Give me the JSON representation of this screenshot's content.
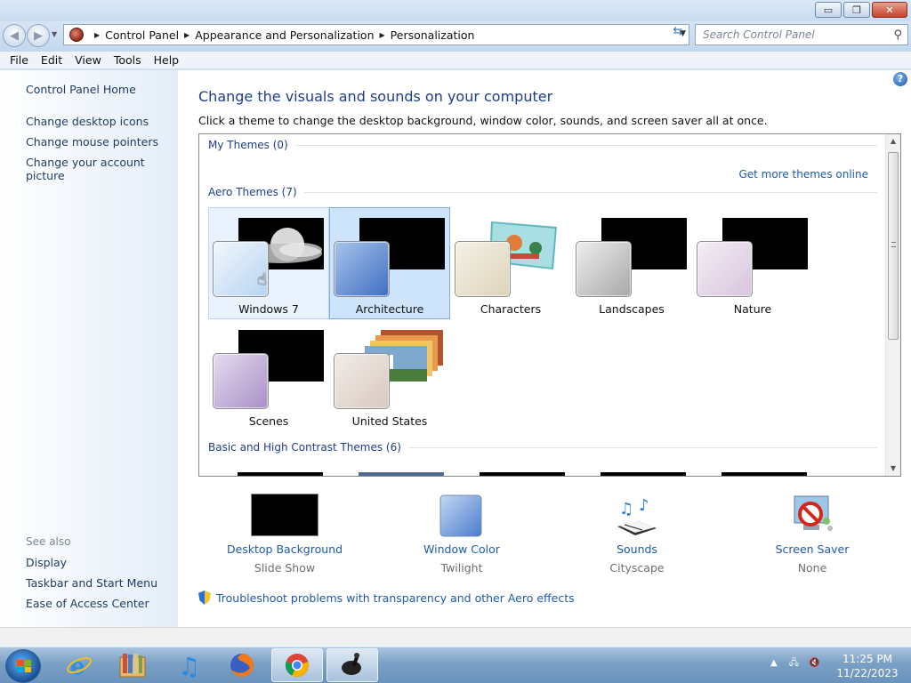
{
  "window": {
    "minimize_glyph": "▭",
    "restore_glyph": "❐",
    "close_glyph": "✕"
  },
  "address": {
    "crumbs": [
      "Control Panel",
      "Appearance and Personalization",
      "Personalization"
    ],
    "search_placeholder": "Search Control Panel"
  },
  "menu": [
    "File",
    "Edit",
    "View",
    "Tools",
    "Help"
  ],
  "sidebar": {
    "home": "Control Panel Home",
    "tasks": [
      "Change desktop icons",
      "Change mouse pointers",
      "Change your account picture"
    ],
    "see_also_label": "See also",
    "see_also": [
      "Display",
      "Taskbar and Start Menu",
      "Ease of Access Center"
    ]
  },
  "main": {
    "title": "Change the visuals and sounds on your computer",
    "subtitle": "Click a theme to change the desktop background, window color, sounds, and screen saver all at once.",
    "get_more_link": "Get more themes online",
    "groups": {
      "my_themes": "My Themes (0)",
      "aero_themes": "Aero Themes (7)",
      "basic_themes": "Basic and High Contrast Themes (6)"
    },
    "themes": [
      {
        "name": "Windows 7",
        "state": "hover"
      },
      {
        "name": "Architecture",
        "state": "selected"
      },
      {
        "name": "Characters",
        "state": "normal"
      },
      {
        "name": "Landscapes",
        "state": "normal"
      },
      {
        "name": "Nature",
        "state": "normal"
      },
      {
        "name": "Scenes",
        "state": "normal"
      },
      {
        "name": "United States",
        "state": "normal"
      }
    ]
  },
  "settings": [
    {
      "label": "Desktop Background",
      "value": "Slide Show",
      "icon": "desktop-background-icon"
    },
    {
      "label": "Window Color",
      "value": "Twilight",
      "icon": "window-color-icon"
    },
    {
      "label": "Sounds",
      "value": "Cityscape",
      "icon": "sounds-icon"
    },
    {
      "label": "Screen Saver",
      "value": "None",
      "icon": "screen-saver-icon"
    }
  ],
  "troubleshoot": "Troubleshoot problems with transparency and other Aero effects",
  "taskbar": {
    "time": "11:25 PM",
    "date": "11/22/2023"
  }
}
